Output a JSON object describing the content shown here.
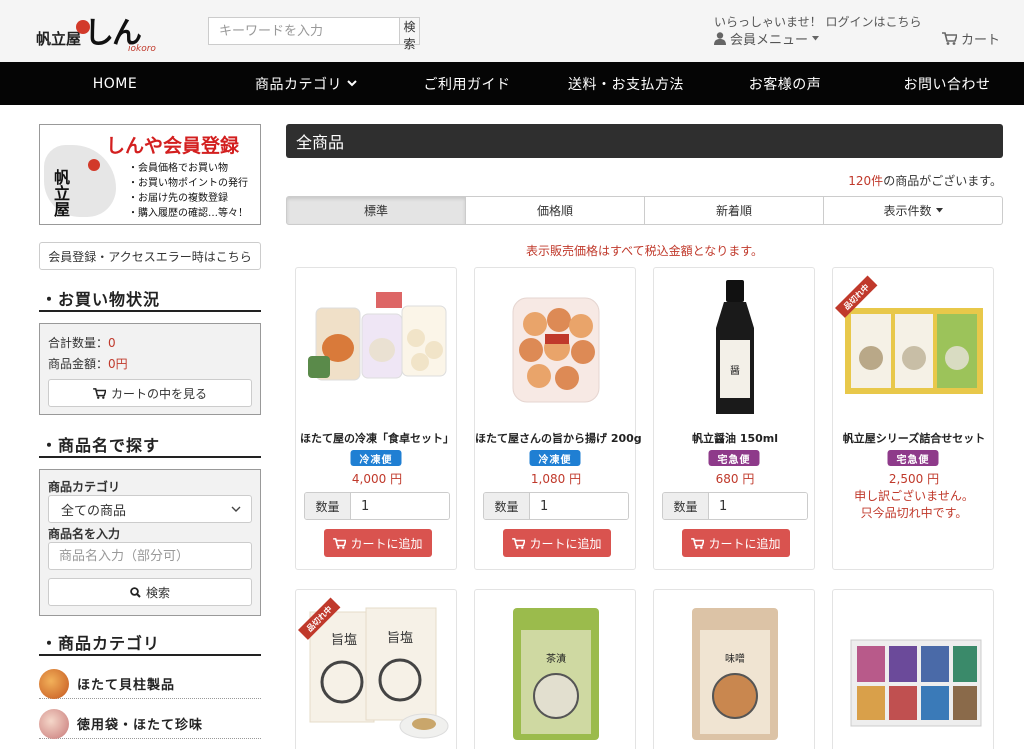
{
  "header": {
    "logo_small": "帆立屋",
    "logo_big": "しんや",
    "logo_roman": "iokoro",
    "search_placeholder": "キーワードを入力",
    "search_button": "検索",
    "welcome": "いらっしゃいませ！ ログインはこちら",
    "member_menu": "会員メニュー",
    "cart": "カート"
  },
  "nav": {
    "items": [
      "HOME",
      "商品カテゴリ",
      "ご利用ガイド",
      "送料・お支払方法",
      "お客様の声",
      "お問い合わせ"
    ]
  },
  "sidebar": {
    "banner": {
      "title": "しんや会員登録",
      "brand": "帆立屋",
      "items": [
        "・会員価格でお買い物",
        "・お買い物ポイントの発行",
        "・お届け先の複数登録",
        "・購入履歴の確認…等々！"
      ]
    },
    "access_button": "会員登録・アクセスエラー時はこちら",
    "status": {
      "heading": "・お買い物状況",
      "total_qty_label": "合計数量：",
      "total_qty": "0",
      "total_amount_label": "商品金額：",
      "total_amount": "0円",
      "view_cart": "カートの中を見る"
    },
    "search": {
      "heading": "・商品名で探す",
      "category_label": "商品カテゴリ",
      "category_value": "全ての商品",
      "name_label": "商品名を入力",
      "name_placeholder": "商品名入力（部分可）",
      "button": "検索"
    },
    "categories": {
      "heading": "・商品カテゴリ",
      "items": [
        "ほたて貝柱製品",
        "徳用袋・ほたて珍味"
      ]
    }
  },
  "main": {
    "title": "全商品",
    "count_number": "120件",
    "count_suffix": "の商品がございます。",
    "sort_tabs": [
      "標準",
      "価格順",
      "新着順",
      "表示件数"
    ],
    "tax_note": "表示販売価格はすべて税込金額となります。",
    "qty_label": "数量",
    "add_to_cart": "カートに追加",
    "products": [
      {
        "name": "ほたて屋の冷凍「食卓セット」",
        "shipping": "冷凍便",
        "price": "4,000 円",
        "qty": "1"
      },
      {
        "name": "ほたて屋さんの旨から揚げ 200g",
        "shipping": "冷凍便",
        "price": "1,080 円",
        "qty": "1"
      },
      {
        "name": "帆立醤油 150ml",
        "shipping": "宅急便",
        "price": "680 円",
        "qty": "1"
      },
      {
        "name": "帆立屋シリーズ詰合せセット",
        "shipping": "宅急便",
        "price": "2,500 円",
        "sold_out_1": "申し訳ございません。",
        "sold_out_2": "只今品切れ中です。",
        "ribbon": "品切れ中"
      }
    ],
    "row2_ribbon": "品切れ中"
  },
  "colors": {
    "frozen_badge": "#1f7fd3",
    "delivery_badge": "#8e3a8a",
    "add_button": "#d9534f",
    "price": "#c0392b"
  }
}
